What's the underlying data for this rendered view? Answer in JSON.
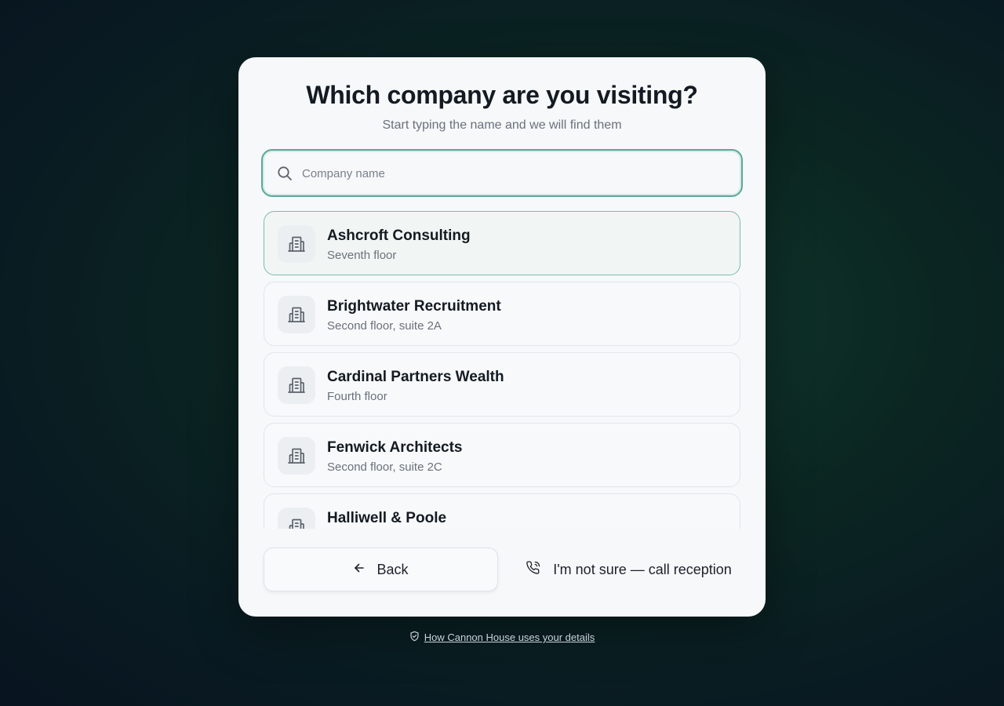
{
  "header": {
    "title": "Which company are you visiting?",
    "subtitle": "Start typing the name and we will find them"
  },
  "search": {
    "placeholder": "Company name",
    "value": "",
    "icon": "search-icon"
  },
  "companies": [
    {
      "name": "Ashcroft Consulting",
      "location": "Seventh floor",
      "selected": true,
      "icon": "building-icon"
    },
    {
      "name": "Brightwater Recruitment",
      "location": "Second floor, suite 2A",
      "selected": false,
      "icon": "building-icon"
    },
    {
      "name": "Cardinal Partners Wealth",
      "location": "Fourth floor",
      "selected": false,
      "icon": "building-icon"
    },
    {
      "name": "Fenwick Architects",
      "location": "Second floor, suite 2C",
      "selected": false,
      "icon": "building-icon"
    },
    {
      "name": "Halliwell & Poole",
      "location": "",
      "selected": false,
      "icon": "building-icon"
    }
  ],
  "actions": {
    "back_label": "Back",
    "call_label": "I'm not sure — call reception"
  },
  "footer": {
    "privacy_link": "How Cannon House uses your details"
  },
  "colors": {
    "accent": "#5aa898",
    "card": "#f6f8fa",
    "text": "#141a22"
  }
}
